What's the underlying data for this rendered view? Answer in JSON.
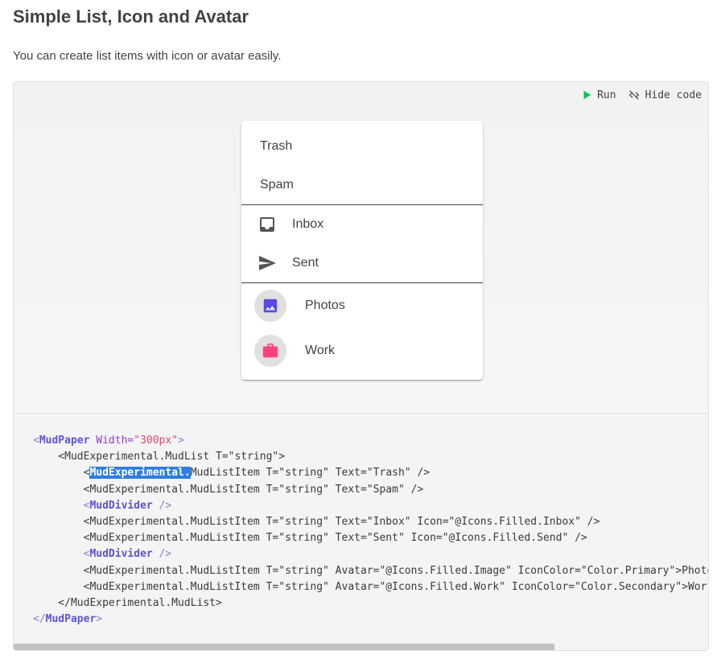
{
  "heading": "Simple List, Icon and Avatar",
  "description": "You can create list items with icon or avatar easily.",
  "toolbar": {
    "run_label": "Run",
    "hide_code_label": "Hide code"
  },
  "list": {
    "items": [
      {
        "label": "Trash"
      },
      {
        "label": "Spam"
      },
      {
        "label": "Inbox",
        "icon": "inbox-icon"
      },
      {
        "label": "Sent",
        "icon": "send-icon"
      },
      {
        "label": "Photos",
        "avatar": "image-icon",
        "icon_color": "#594ae2"
      },
      {
        "label": "Work",
        "avatar": "work-icon",
        "icon_color": "#ff4081"
      }
    ]
  },
  "code": {
    "l1_open": "<",
    "l1_tag": "MudPaper",
    "l1_attr": " Width=",
    "l1_val": "\"300px\"",
    "l1_close": ">",
    "l2": "    <MudExperimental.MudList T=\"string\">",
    "l3_pre": "        <",
    "l3_hl": "MudExperimental.",
    "l3_rest": "MudListItem T=\"string\" Text=\"Trash\" />",
    "l4": "        <MudExperimental.MudListItem T=\"string\" Text=\"Spam\" />",
    "l5_pre": "        <",
    "l5_tag": "MudDivider",
    "l5_close": " />",
    "l6": "        <MudExperimental.MudListItem T=\"string\" Text=\"Inbox\" Icon=\"@Icons.Filled.Inbox\" />",
    "l7": "        <MudExperimental.MudListItem T=\"string\" Text=\"Sent\" Icon=\"@Icons.Filled.Send\" />",
    "l8_pre": "        <",
    "l8_tag": "MudDivider",
    "l8_close": " />",
    "l9": "        <MudExperimental.MudListItem T=\"string\" Avatar=\"@Icons.Filled.Image\" IconColor=\"Color.Primary\">Photos</MudExperimental.MudListItem>",
    "l10": "        <MudExperimental.MudListItem T=\"string\" Avatar=\"@Icons.Filled.Work\" IconColor=\"Color.Secondary\">Work</MudExperimental.MudListItem>",
    "l11": "    </MudExperimental.MudList>",
    "l12_open": "</",
    "l12_tag": "MudPaper",
    "l12_close": ">"
  },
  "colors": {
    "run_green": "#00c853",
    "primary": "#594ae2",
    "secondary": "#ff4081"
  }
}
